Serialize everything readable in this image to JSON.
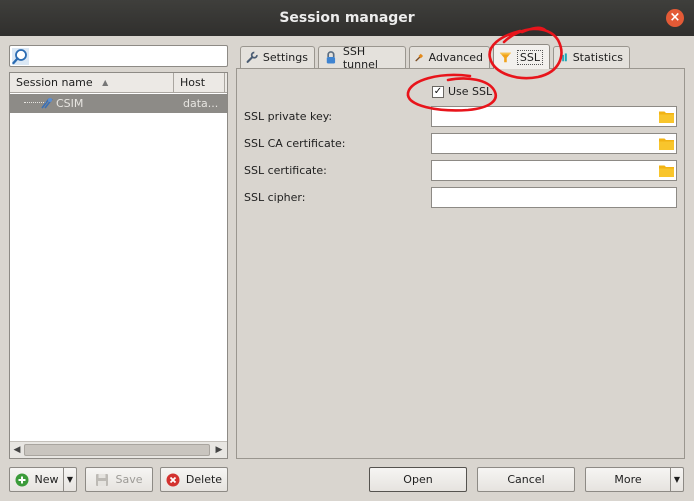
{
  "window": {
    "title": "Session manager",
    "close_glyph": "×"
  },
  "sidebar": {
    "search": {
      "value": "",
      "placeholder": "",
      "icon": "search-icon"
    },
    "columns": {
      "name": "Session name",
      "host": "Host"
    },
    "sessions": [
      {
        "name": "CSIM",
        "host": "data...",
        "icon": "server-icon",
        "selected": true
      }
    ],
    "buttons": {
      "new_label": "New",
      "save_label": "Save",
      "delete_label": "Delete"
    }
  },
  "tabs": [
    {
      "label": "Settings",
      "icon": "wrench-icon"
    },
    {
      "label": "SSH tunnel",
      "icon": "lock-icon"
    },
    {
      "label": "Advanced",
      "icon": "hammer-icon"
    },
    {
      "label": "SSL",
      "icon": "ssl-shield-icon",
      "active": true
    },
    {
      "label": "Statistics",
      "icon": "bar-chart-icon"
    }
  ],
  "ssl": {
    "use_ssl": {
      "label": "Use SSL",
      "checked": true
    },
    "fields": [
      {
        "label": "SSL private key:",
        "value": ""
      },
      {
        "label": "SSL CA certificate:",
        "value": ""
      },
      {
        "label": "SSL certificate:",
        "value": ""
      },
      {
        "label": "SSL cipher:",
        "value": ""
      }
    ]
  },
  "footer": {
    "open_label": "Open",
    "cancel_label": "Cancel",
    "more_label": "More"
  },
  "colors": {
    "annotation": "#e8141b",
    "selection": "#8d8b87",
    "titlebar": "#353432",
    "close": "#e35a36"
  }
}
